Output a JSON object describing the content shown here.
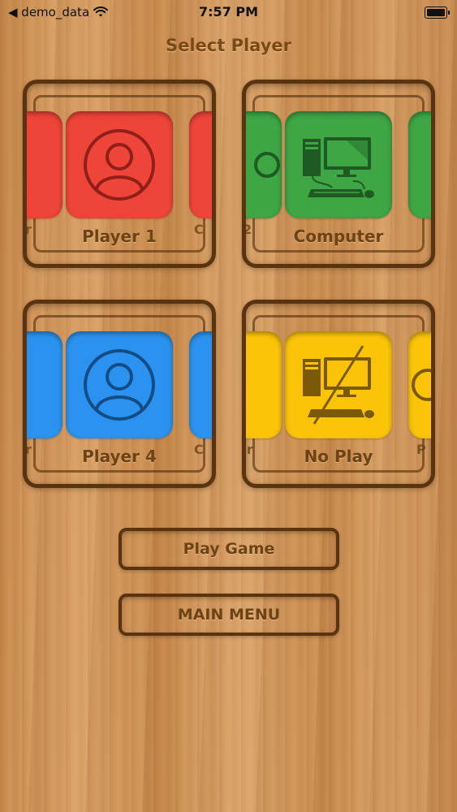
{
  "status_bar": {
    "back_label": "◀ demo_data",
    "time": "7:57 PM"
  },
  "screen_title": "Select Player",
  "panels": [
    {
      "selected": "Player 1",
      "left_peek": "r",
      "right_peek": "C",
      "color": "#ef4438"
    },
    {
      "selected": "Computer",
      "left_peek": "2",
      "right_peek": "",
      "color": "#3ea645"
    },
    {
      "selected": "Player 4",
      "left_peek": "r",
      "right_peek": "C",
      "color": "#2b93ef"
    },
    {
      "selected": "No Play",
      "left_peek": "er",
      "right_peek": "P",
      "color": "#fbc409"
    }
  ],
  "buttons": {
    "play": "Play Game",
    "menu": "MAIN MENU"
  },
  "icons": [
    "wifi-icon",
    "battery-icon",
    "user-icon",
    "computer-icon",
    "no-play-icon"
  ]
}
